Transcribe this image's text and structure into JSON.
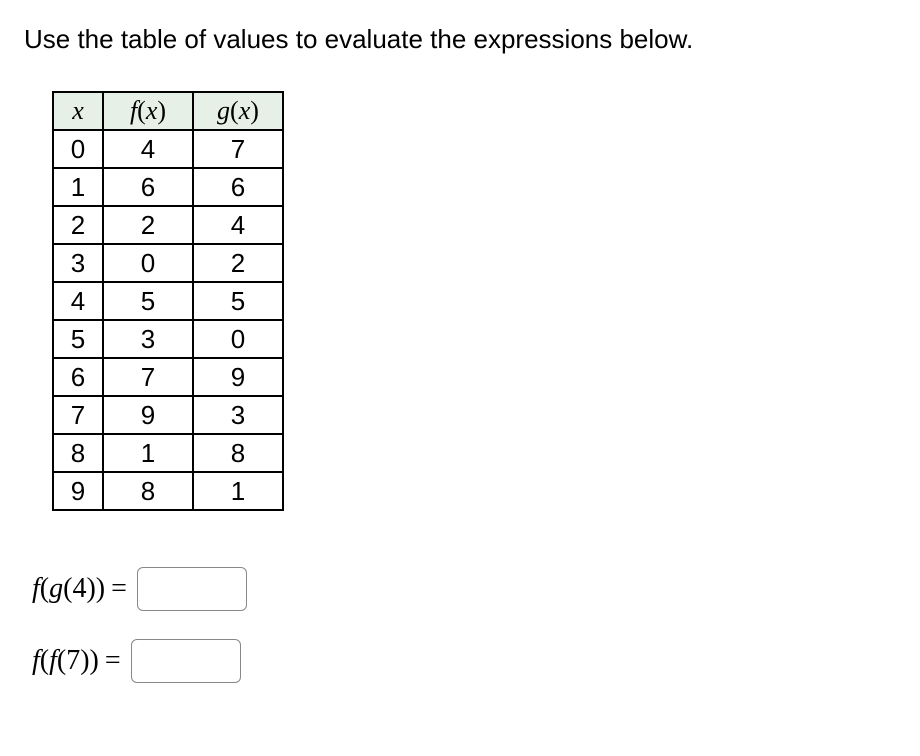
{
  "instruction": "Use the table of values to evaluate the expressions below.",
  "table": {
    "headers": {
      "x": "x",
      "f": "f(x)",
      "g": "g(x)"
    },
    "rows": [
      {
        "x": "0",
        "f": "4",
        "g": "7"
      },
      {
        "x": "1",
        "f": "6",
        "g": "6"
      },
      {
        "x": "2",
        "f": "2",
        "g": "4"
      },
      {
        "x": "3",
        "f": "0",
        "g": "2"
      },
      {
        "x": "4",
        "f": "5",
        "g": "5"
      },
      {
        "x": "5",
        "f": "3",
        "g": "0"
      },
      {
        "x": "6",
        "f": "7",
        "g": "9"
      },
      {
        "x": "7",
        "f": "9",
        "g": "3"
      },
      {
        "x": "8",
        "f": "1",
        "g": "8"
      },
      {
        "x": "9",
        "f": "8",
        "g": "1"
      }
    ]
  },
  "expressions": [
    {
      "label_html": "f(g(4)) =",
      "value": ""
    },
    {
      "label_html": "f(f(7)) =",
      "value": ""
    }
  ]
}
